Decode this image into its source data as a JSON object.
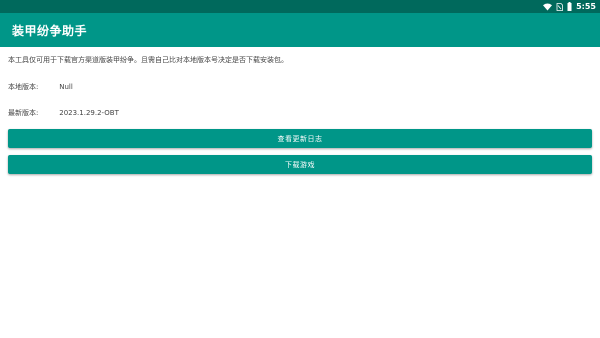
{
  "status_bar": {
    "time": "5:55",
    "icons": [
      "wifi-icon",
      "sim-icon",
      "battery-icon"
    ]
  },
  "app_bar": {
    "title": "装甲纷争助手"
  },
  "main": {
    "description": "本工具仅可用于下载官方渠道版装甲纷争。且需自己比对本地版本号决定是否下载安装包。",
    "local_version": {
      "label": "本地版本:",
      "value": "Null"
    },
    "latest_version": {
      "label": "最新版本:",
      "value": "2023.1.29.2-OBT"
    },
    "buttons": {
      "changelog": "查看更新日志",
      "download": "下载游戏"
    }
  },
  "colors": {
    "status_bar": "#00695c",
    "primary": "#009688"
  }
}
